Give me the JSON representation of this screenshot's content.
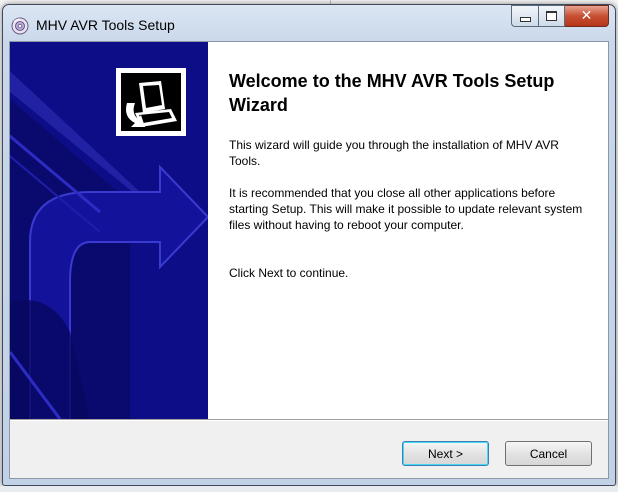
{
  "window": {
    "title": "MHV AVR Tools Setup",
    "minimize_label": "minimize",
    "maximize_label": "maximize",
    "close_label": "close"
  },
  "wizard": {
    "heading": "Welcome to the MHV AVR Tools Setup Wizard",
    "paragraph1": "This wizard will guide you through the installation of MHV AVR Tools.",
    "paragraph2": "It is recommended that you close all other applications before starting Setup. This will make it possible to update relevant system files without having to reboot your computer.",
    "paragraph3": "Click Next to continue."
  },
  "buttons": {
    "next": "Next >",
    "cancel": "Cancel"
  },
  "icons": {
    "app": "installer-disc-icon",
    "logo": "installer-computer-icon",
    "sidebar_art": "installer-arrow-art"
  },
  "colors": {
    "sidebar_bg": "#0d0d87",
    "title_bar": "#c8d7ea",
    "close_button": "#c64f31",
    "focus_border": "#3c7fb1"
  }
}
